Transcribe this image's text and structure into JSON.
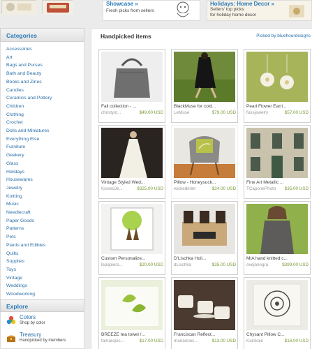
{
  "promos": [
    {
      "title": "Showcase »",
      "subtitle": "Fresh picks from sellers"
    },
    {
      "title": "Holidays: Home Decor »",
      "subtitle_line1": "Sellers' top picks",
      "subtitle_line2": "for holiday home decor"
    }
  ],
  "sidebar": {
    "categories_title": "Categories",
    "categories": [
      "Accessories",
      "Art",
      "Bags and Purses",
      "Bath and Beauty",
      "Books and Zines",
      "Candles",
      "Ceramics and Pottery",
      "Children",
      "Clothing",
      "Crochet",
      "Dolls and Miniatures",
      "Everything Else",
      "Furniture",
      "Geekery",
      "Glass",
      "Holidays",
      "Housewares",
      "Jewelry",
      "Knitting",
      "Music",
      "Needlecraft",
      "Paper Goods",
      "Patterns",
      "Pets",
      "Plants and Edibles",
      "Quilts",
      "Supplies",
      "Toys",
      "Vintage",
      "Weddings",
      "Woodworking"
    ],
    "explore_title": "Explore",
    "explore": [
      {
        "title": "Colors",
        "subtitle": "Shop by color"
      },
      {
        "title": "Treasury",
        "subtitle": "Handpicked by members"
      }
    ]
  },
  "main": {
    "title": "Handpicked items",
    "picked_by": "Picked by bluehourdesigns",
    "items": [
      {
        "title": "Fall collection - ...",
        "shop": "christyst...",
        "price": "$49.00 USD"
      },
      {
        "title": "BlackMuse for cold...",
        "shop": "LeMuse",
        "price": "$79.00 USD"
      },
      {
        "title": "Pearl Flower Earri...",
        "shop": "fussjewelry",
        "price": "$57.00 USD"
      },
      {
        "title": "Vintage Styled Wed...",
        "shop": "KissedJe...",
        "price": "$325.00 USD"
      },
      {
        "title": "Pillow - Honeysuck...",
        "shop": "wickedmint",
        "price": "$24.00 USD"
      },
      {
        "title": "Fine Art Metallic ...",
        "shop": "TCaponePhoto",
        "price": "$35.00 USD"
      },
      {
        "title": "Custom Personalize...",
        "shop": "lepapiers...",
        "price": "$20.00 USD"
      },
      {
        "title": "D'Lischka Holi...",
        "shop": "dLischka",
        "price": "$35.00 USD"
      },
      {
        "title": "MIA hand knitted c...",
        "shop": "ovejanegra",
        "price": "$399.00 USD"
      },
      {
        "title": "BREEZE tea towel /...",
        "shop": "tamarquis...",
        "price": "$17.00 USD"
      },
      {
        "title": "Franciscan Reflect...",
        "shop": "mariannec...",
        "price": "$13.00 USD"
      },
      {
        "title": "Chysant Pillow C...",
        "shop": "Kainkain",
        "price": "$16.00 USD"
      }
    ]
  }
}
